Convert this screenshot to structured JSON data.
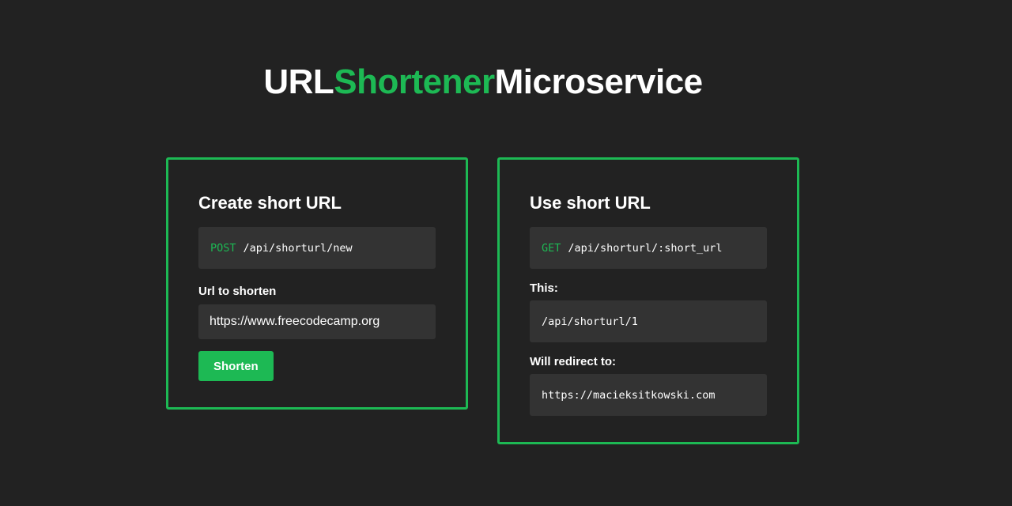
{
  "header": {
    "title_part1": "URL",
    "title_part2": "Shortener",
    "title_part3": "Microservice"
  },
  "create_card": {
    "heading": "Create short URL",
    "method": "POST",
    "endpoint": "/api/shorturl/new",
    "input_label": "Url to shorten",
    "input_value": "https://www.freecodecamp.org",
    "button_label": "Shorten"
  },
  "use_card": {
    "heading": "Use short URL",
    "method": "GET",
    "endpoint": "/api/shorturl/:short_url",
    "this_label": "This:",
    "this_value": "/api/shorturl/1",
    "redirect_label": "Will redirect to:",
    "redirect_value": "https://macieksitkowski.com"
  },
  "colors": {
    "background": "#222222",
    "accent": "#1db954",
    "box": "#333333",
    "text": "#ffffff"
  }
}
